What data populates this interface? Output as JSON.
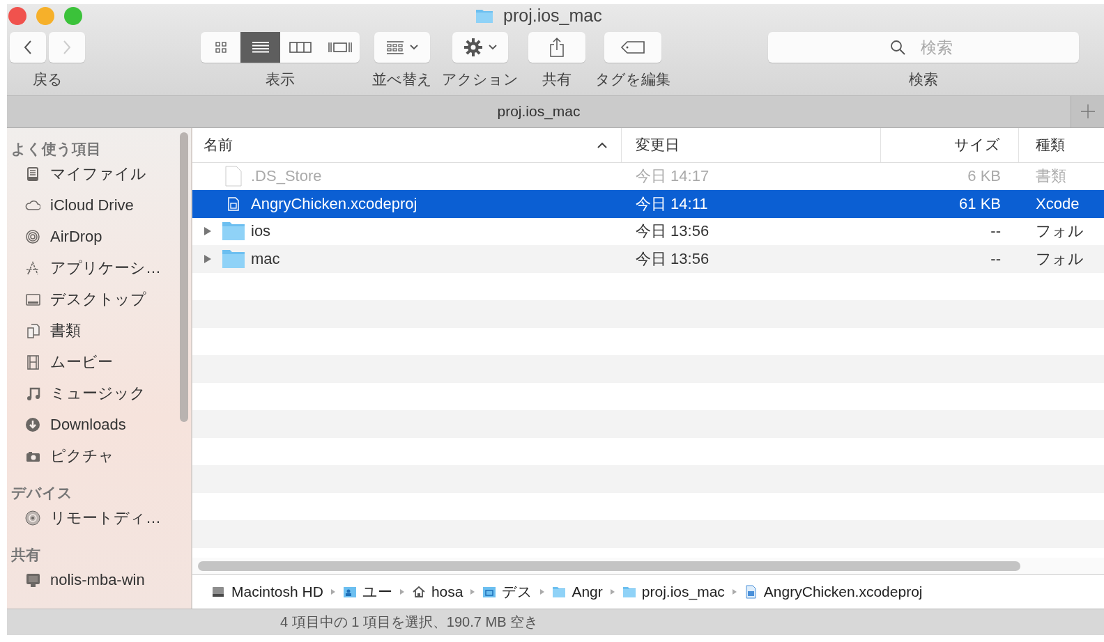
{
  "window": {
    "title": "proj.ios_mac"
  },
  "toolbar": {
    "back_label": "戻る",
    "view_modes": [
      {
        "kind": "icons",
        "selected": false
      },
      {
        "kind": "list",
        "selected": true
      },
      {
        "kind": "columns",
        "selected": false
      },
      {
        "kind": "coverflow",
        "selected": false
      }
    ],
    "view_label": "表示",
    "sort_label": "並べ替え",
    "action_label": "アクション",
    "share_label": "共有",
    "tags_label": "タグを編集",
    "search": {
      "placeholder": "検索",
      "label": "検索"
    }
  },
  "tab": {
    "title": "proj.ios_mac"
  },
  "sidebar": {
    "sections": [
      {
        "heading": "よく使う項目",
        "items": [
          {
            "label": "マイファイル",
            "kind": "myfiles"
          },
          {
            "label": "iCloud Drive",
            "kind": "cloud"
          },
          {
            "label": "AirDrop",
            "kind": "airdrop"
          },
          {
            "label": "アプリケーシ…",
            "kind": "apps"
          },
          {
            "label": "デスクトップ",
            "kind": "desktop"
          },
          {
            "label": "書類",
            "kind": "docs"
          },
          {
            "label": "ムービー",
            "kind": "movies"
          },
          {
            "label": "ミュージック",
            "kind": "music"
          },
          {
            "label": "Downloads",
            "kind": "downloads"
          },
          {
            "label": "ピクチャ",
            "kind": "pictures"
          }
        ]
      },
      {
        "heading": "デバイス",
        "items": [
          {
            "label": "リモートディ…",
            "kind": "disc"
          }
        ]
      },
      {
        "heading": "共有",
        "items": [
          {
            "label": "nolis-mba-win",
            "kind": "computer"
          }
        ]
      }
    ]
  },
  "table": {
    "columns": [
      {
        "label": "名前",
        "sorted": true
      },
      {
        "label": "変更日"
      },
      {
        "label": "サイズ"
      },
      {
        "label": "種類"
      }
    ],
    "rows": [
      {
        "name": ".DS_Store",
        "date": "今日 14:17",
        "size": "6 KB",
        "kind_label": "書類",
        "kind": "file",
        "hidden": true,
        "expandable": false,
        "selected": false
      },
      {
        "name": "AngryChicken.xcodeproj",
        "date": "今日 14:11",
        "size": "61 KB",
        "kind_label": "Xcode",
        "kind": "project",
        "hidden": false,
        "expandable": false,
        "selected": true
      },
      {
        "name": "ios",
        "date": "今日 13:56",
        "size": "--",
        "kind_label": "フォル",
        "kind": "folder",
        "hidden": false,
        "expandable": true,
        "selected": false
      },
      {
        "name": "mac",
        "date": "今日 13:56",
        "size": "--",
        "kind_label": "フォル",
        "kind": "folder",
        "hidden": false,
        "expandable": true,
        "selected": false
      }
    ]
  },
  "path_bar": [
    {
      "label": "Macintosh HD",
      "kind": "disk"
    },
    {
      "label": "ユー",
      "kind": "users"
    },
    {
      "label": "hosa",
      "kind": "home"
    },
    {
      "label": "デス",
      "kind": "desktopfolder"
    },
    {
      "label": "Angr",
      "kind": "folder"
    },
    {
      "label": "proj.ios_mac",
      "kind": "folder"
    },
    {
      "label": "AngryChicken.xcodeproj",
      "kind": "project"
    }
  ],
  "status_bar": "4 項目中の 1 項目を選択、190.7 MB 空き"
}
